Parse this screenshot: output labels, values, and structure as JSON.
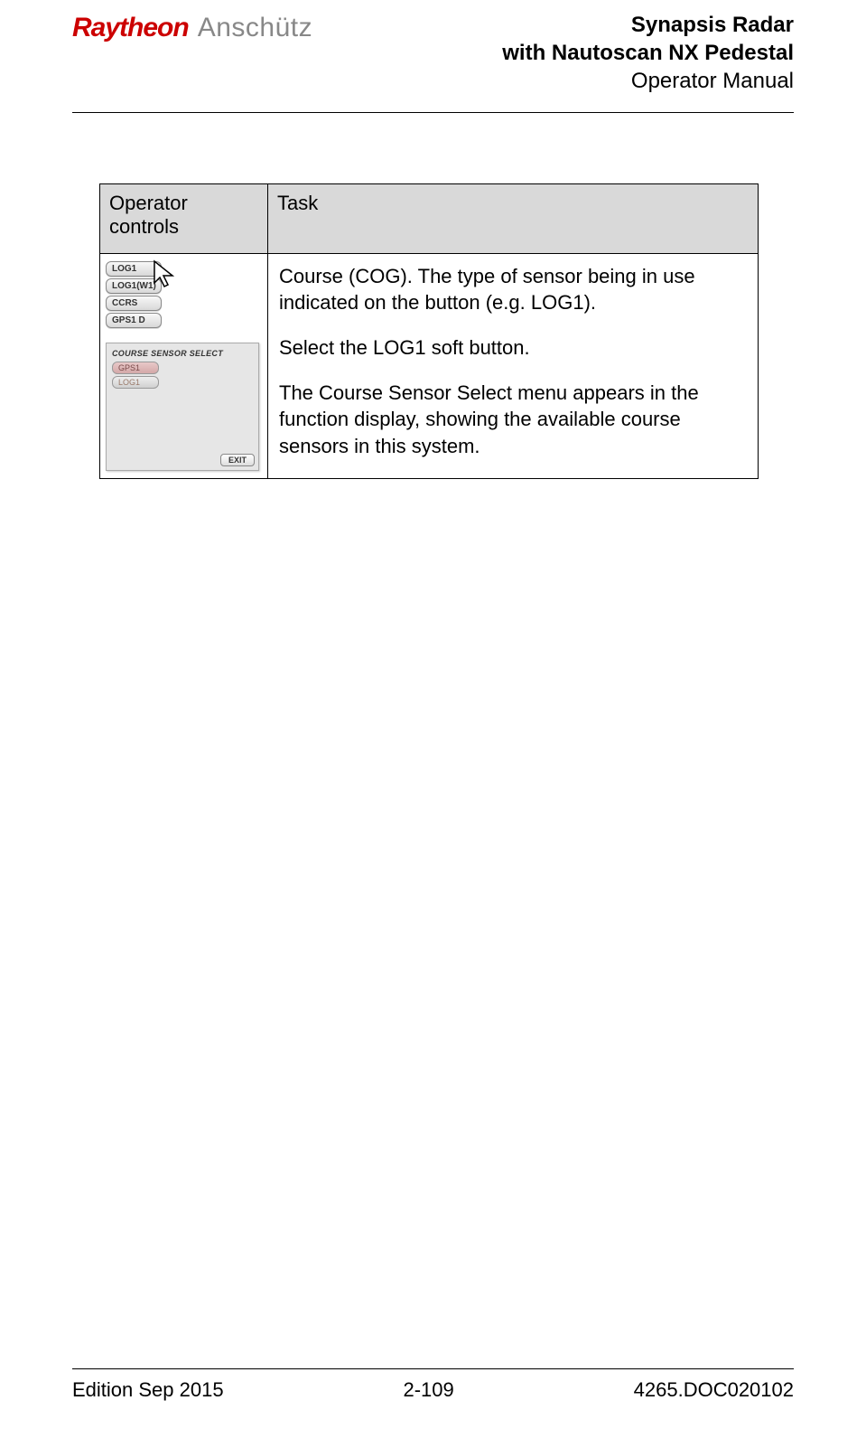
{
  "header": {
    "logo_brand": "Raytheon",
    "logo_sub": "Anschütz",
    "title1": "Synapsis Radar",
    "title2": "with Nautoscan NX Pedestal",
    "title3": "Operator Manual"
  },
  "table": {
    "col1_header": "Operator controls",
    "col2_header": "Task",
    "buttons": {
      "b1": "LOG1",
      "b2": "LOG1(W1)",
      "b3": "CCRS",
      "b4": "GPS1 D"
    },
    "panel": {
      "title": "COURSE SENSOR SELECT",
      "item1": "GPS1",
      "item2": "LOG1",
      "exit": "EXIT"
    },
    "task": {
      "p1": "Course (COG). The type of sensor being in use indicated on the button (e.g. LOG1).",
      "p2": "Select the LOG1 soft button.",
      "p3": "The Course Sensor Select menu appears in the function display, showing the available course sensors in this system."
    }
  },
  "footer": {
    "left": "Edition Sep 2015",
    "center": "2-109",
    "right": "4265.DOC020102"
  }
}
